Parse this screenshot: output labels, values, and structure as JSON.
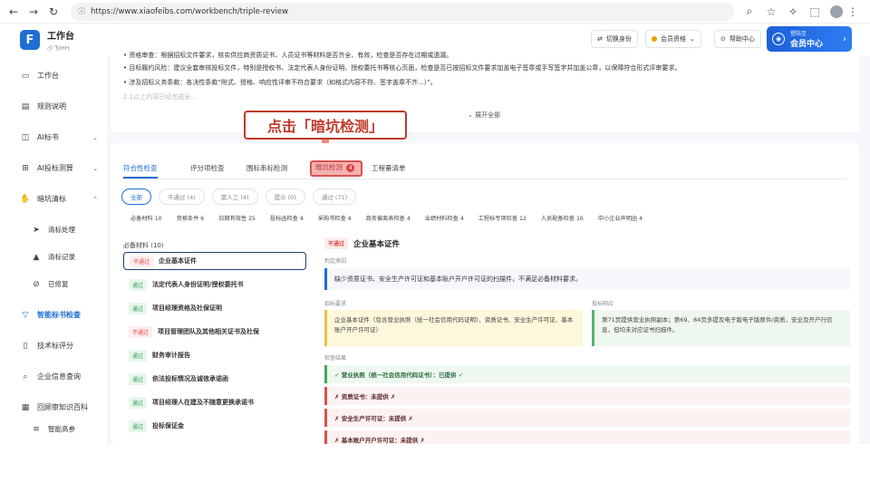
{
  "browser": {
    "url": "https://www.xiaofeibs.com/workbench/triple-review"
  },
  "app": {
    "title": "工作台",
    "subtitle": "小飞IHH",
    "header_buttons": [
      "切换身份",
      "会员资格",
      "帮助中心"
    ],
    "vip_label": "登陆至",
    "vip_title": "会员中心"
  },
  "sidebar": {
    "items": [
      {
        "label": "工作台",
        "icon": "monitor-icon"
      },
      {
        "label": "规则说明",
        "icon": "document-icon"
      },
      {
        "label": "AI标书",
        "icon": "ai-icon"
      },
      {
        "label": "AI投标测算",
        "icon": "calculator-icon"
      },
      {
        "label": "暗坑清标",
        "icon": "hand-icon"
      },
      {
        "label": "清标处理",
        "icon": "send-icon"
      },
      {
        "label": "清标记录",
        "icon": "triangle-icon"
      },
      {
        "label": "已修复",
        "icon": "check-circle-icon"
      },
      {
        "label": "智能标书检查",
        "icon": "funnel-icon"
      },
      {
        "label": "技术标评分",
        "icon": "book-icon"
      },
      {
        "label": "企业信息查询",
        "icon": "search-icon"
      },
      {
        "label": "回顾审知识百科",
        "icon": "grid-icon"
      },
      {
        "label": "智能高参",
        "icon": "list-icon"
      }
    ]
  },
  "topcard": {
    "bullets": [
      "资格审查：根据招标文件要求，核实供应商资质证书、人员证书等材料是否齐全、有效，检查是否存在过期或遗漏。",
      "目标履约风险：建议全套审核投标文件，特别是授权书、法定代表人身份证明、授权委托书等核心页面，检查是否已按招标文件要求加盖电子签章或手写签字并加盖公章，以保障符合形式评审要求。",
      "涉及招标义务条款：各决性条款“附式、授格、响应性评审不符合要求（如格式内容不符、签字盖章不齐...）”。",
      "2.1以上内容已经完成全..."
    ],
    "expand_label": "展开全部"
  },
  "annotation": {
    "text": "点击「暗坑检测」"
  },
  "tabs": [
    {
      "label": "符合性检查",
      "active": true
    },
    {
      "label": "评分项检查",
      "active": false
    },
    {
      "label": "围标串标检测",
      "active": false
    },
    {
      "label": "暗坑检测",
      "active": false,
      "badge": "4"
    },
    {
      "label": "工程量清单",
      "active": false
    }
  ],
  "filters": [
    "全部",
    "不通过 (4)",
    "需人工 (4)",
    "提示 (0)",
    "通过 (71)"
  ],
  "categories": [
    "必备材料 10",
    "资格条件 6",
    "日期有效性 25",
    "投标函检查 4",
    "采购书检查 4",
    "商务偏离表检查 4",
    "业绩材料检查 4",
    "工程标专项检查 12",
    "人员配备检查 16",
    "中小企业声明函 4"
  ],
  "list": {
    "header": "必备材料 (10)",
    "items": [
      {
        "status": "不通过",
        "name": "企业基本证件"
      },
      {
        "status": "通过",
        "name": "法定代表人身份证明/授权委托书"
      },
      {
        "status": "通过",
        "name": "项目经理资格及社保证明"
      },
      {
        "status": "不通过",
        "name": "项目管理团队及其他相关证书及社保"
      },
      {
        "status": "通过",
        "name": "财务审计报告"
      },
      {
        "status": "通过",
        "name": "依法投标情况及诚信承诺函"
      },
      {
        "status": "通过",
        "name": "项目经理人在建及不随意更换承诺书"
      },
      {
        "status": "通过",
        "name": "投标保证金"
      }
    ]
  },
  "detail": {
    "status": "不通过",
    "title": "企业基本证件",
    "reason_label": "判定原因",
    "reason": "缺少资质证书、安全生产许可证和基本账户开户许可证的扫描件，不满足必备材料要求。",
    "left_label": "招标要求",
    "left_text": "企业基本证件（包含营业执照（统一社会信用代码证明）、资质证书、安全生产许可证、基本账户开户许可证）",
    "right_label": "投标响应",
    "right_text": "第71页提供营业执照副本；第69、84页多提及电子版电子版原件/资质，安全及开户行信息，但均未对应证书扫描件。",
    "checks_label": "检查结果",
    "checks": [
      {
        "ok": true,
        "text": "✓ 营业执照（统一社会信用代码证书）：已提供 ✓"
      },
      {
        "ok": false,
        "text": "✗ 资质证书：未提供 ✗"
      },
      {
        "ok": false,
        "text": "✗ 安全生产许可证：未提供 ✗"
      },
      {
        "ok": false,
        "text": "✗ 基本账户开户许可证：未提供 ✗"
      }
    ]
  }
}
